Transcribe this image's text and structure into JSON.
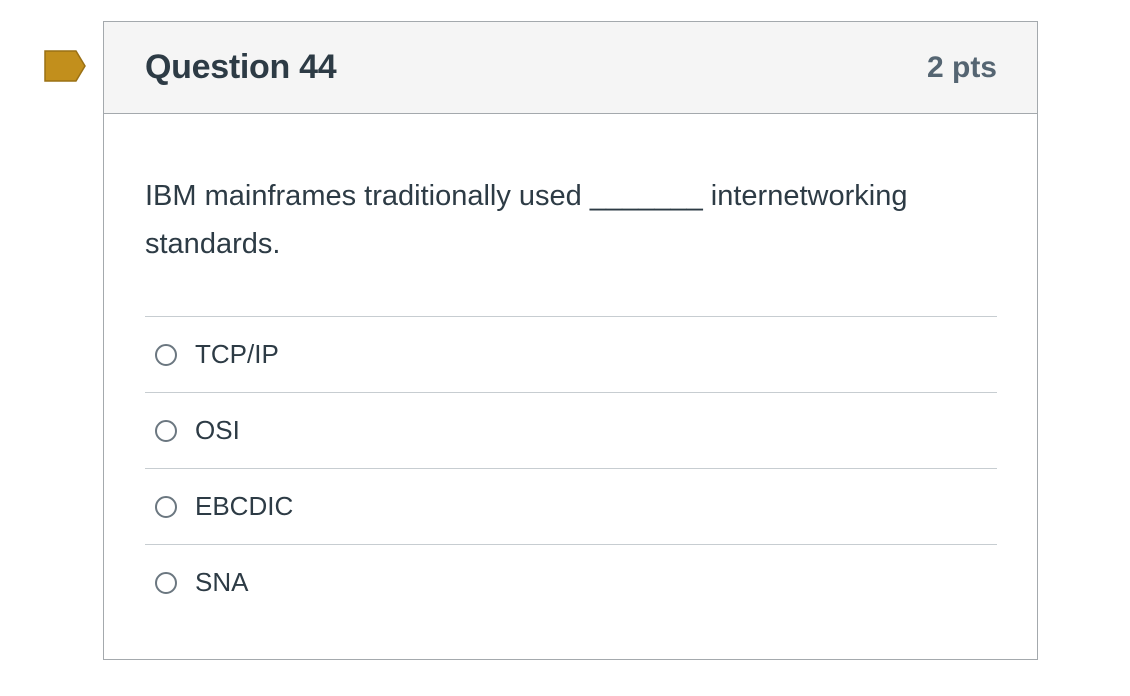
{
  "flag": {
    "icon": "flag-icon",
    "color": "#c28f1c"
  },
  "question": {
    "title": "Question 44",
    "points": "2 pts",
    "text": "IBM mainframes traditionally used _______ internetworking standards.",
    "answers": [
      {
        "label": "TCP/IP",
        "selected": false
      },
      {
        "label": "OSI",
        "selected": false
      },
      {
        "label": "EBCDIC",
        "selected": false
      },
      {
        "label": "SNA",
        "selected": false
      }
    ]
  }
}
